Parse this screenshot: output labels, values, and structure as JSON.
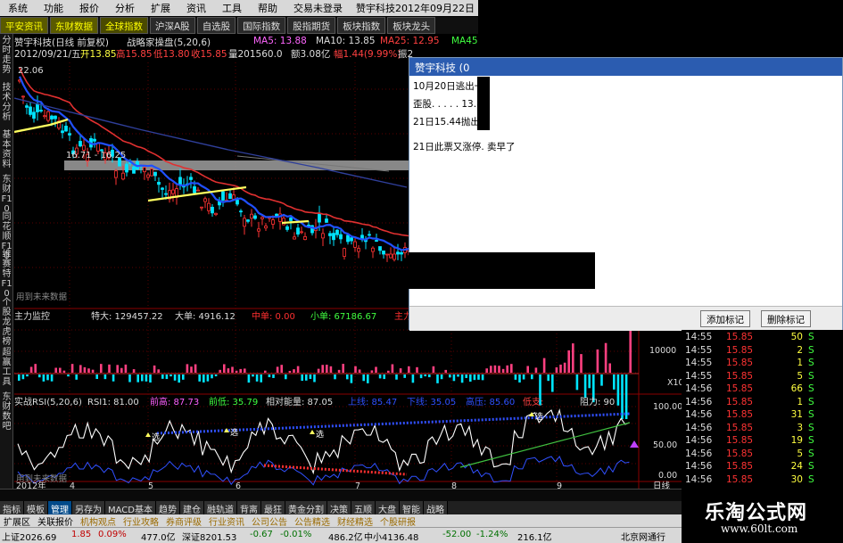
{
  "menu": {
    "items": [
      "系统",
      "功能",
      "报价",
      "分析",
      "扩展",
      "资讯",
      "工具",
      "帮助",
      "交易未登录"
    ],
    "title": "赞宇科技2012年09月22日"
  },
  "tabs": [
    "平安资讯",
    "东财数据",
    "全球指数",
    "沪深A股",
    "自选股",
    "国际指数",
    "股指期货",
    "板块指数",
    "板块龙头"
  ],
  "sidebar": [
    {
      "label": "分时走势"
    },
    {
      "label": "技术分析"
    },
    {
      "label": "基本资料"
    },
    {
      "label": "东财F10"
    },
    {
      "label": "同花顺F10"
    },
    {
      "label": "维赛特F10"
    },
    {
      "label": "个股龙虎榜"
    },
    {
      "label": "超赢工具"
    },
    {
      "label": "东财数吧"
    }
  ],
  "header": {
    "stock_name": "赞宇科技(日线 前复权)",
    "indicator": "战略家操盘(5,20,6)",
    "ma5": "MA5: 13.88",
    "ma10": "MA10: 13.85",
    "ma25": "MA25: 12.95",
    "ma45": "MA45",
    "date": "2012/09/21/五",
    "open": "开13.85",
    "high": "高15.85",
    "low": "低13.80",
    "close": "收15.85",
    "volume": "量201560.0",
    "amount": "额3.08亿",
    "change": "幅1.44(9.99%)",
    "amp": "振2"
  },
  "chart_labels": {
    "high_price": "22.06",
    "band_range": "16.71 - 16.25",
    "future_data": "用到未来数据"
  },
  "main_ctrl": {
    "title": "主力监控",
    "tedа": "特大: 129457.22",
    "da": "大单: 4916.12",
    "zhong": "中单: 0.00",
    "xiao": "小单: 67186.67",
    "zhu": "主力",
    "axis_10000": "10000",
    "axis_x10": "X10"
  },
  "rsi": {
    "title": "实战RSI(5,20,6)",
    "rsi1": "RSI1: 81.00",
    "qiangao": "前高: 87.73",
    "qiandi": "前低: 35.79",
    "xiangdui": "相对能量: 87.05",
    "shangxian": "上线: 85.47",
    "xiaxian": "下线: 35.05",
    "gaodian": "高压: 85.60",
    "diadian": "低支: ",
    "zuli": "阻力: 90",
    "axis": [
      "100.00",
      "50.00",
      "0.00"
    ],
    "tags": [
      "选",
      "选",
      "选",
      "选"
    ],
    "future_data": "用到未来数据"
  },
  "xaxis": {
    "year": "2012年",
    "ticks": [
      "4",
      "5",
      "6",
      "7",
      "8",
      "9"
    ],
    "period": "日线"
  },
  "dialog": {
    "title": "赞宇科技 (0",
    "lines": [
      "10月20日逃出一",
      "歪股.  .  .  .  .  13.8",
      "21日15.44抛出",
      "21日此票又涨停. 卖早了"
    ],
    "btn_add": "添加标记",
    "btn_del": "删除标记"
  },
  "trades": [
    {
      "time": "14:55",
      "price": "15.85",
      "vol": "50",
      "bs": "S"
    },
    {
      "time": "14:55",
      "price": "15.85",
      "vol": "2",
      "bs": "S"
    },
    {
      "time": "14:55",
      "price": "15.85",
      "vol": "1",
      "bs": "S"
    },
    {
      "time": "14:55",
      "price": "15.85",
      "vol": "5",
      "bs": "S"
    },
    {
      "time": "14:56",
      "price": "15.85",
      "vol": "66",
      "bs": "S"
    },
    {
      "time": "14:56",
      "price": "15.85",
      "vol": "1",
      "bs": "S"
    },
    {
      "time": "14:56",
      "price": "15.85",
      "vol": "31",
      "bs": "S"
    },
    {
      "time": "14:56",
      "price": "15.85",
      "vol": "3",
      "bs": "S"
    },
    {
      "time": "14:56",
      "price": "15.85",
      "vol": "19",
      "bs": "S"
    },
    {
      "time": "14:56",
      "price": "15.85",
      "vol": "5",
      "bs": "S"
    },
    {
      "time": "14:56",
      "price": "15.85",
      "vol": "24",
      "bs": "S"
    },
    {
      "time": "14:56",
      "price": "15.85",
      "vol": "30",
      "bs": "S"
    }
  ],
  "bottom_tabs1": [
    "指标",
    "模板",
    "管理",
    "另存为",
    "MACD基本",
    "趋势",
    "建仓",
    "融轨道",
    "背离",
    "最狂",
    "黄金分割",
    "决策",
    "五顺",
    "大盘",
    "智能",
    "战略"
  ],
  "bottom_tabs2": [
    "扩展区",
    "关联报价",
    "机构观点",
    "行业攻略",
    "券商评级",
    "行业资讯",
    "公司公告",
    "公告精选",
    "财经精选",
    "个股研报"
  ],
  "status": {
    "sh": "上证2026.69",
    "sh_chg": "1.85",
    "sh_pct": "0.09%",
    "sh_amt": "477.0亿",
    "sz": "深证8201.53",
    "sz_chg": "-0.67",
    "sz_pct": "-0.01%",
    "sz_amt": "486.2亿",
    "zx": "中小4136.48",
    "zx_chg": "-52.00",
    "zx_pct": "-1.24%",
    "zx_amt": "216.1亿",
    "broker": "北京网通行"
  },
  "watermark": {
    "name": "乐淘公式网",
    "url": "www.60lt.com"
  },
  "colors": {
    "up": "#ff3333",
    "down": "#00e5ff",
    "ma_red": "#e03030",
    "ma_blue": "#2050ff",
    "ma_yellow": "#ffff60",
    "grid": "#5a0000"
  },
  "chart_data": {
    "type": "candlestick",
    "x": [
      "4",
      "5",
      "6",
      "7",
      "8",
      "9"
    ],
    "y_high": 22.06,
    "band": [
      16.71,
      16.25
    ],
    "rsi_axis": [
      100,
      50,
      0
    ]
  }
}
